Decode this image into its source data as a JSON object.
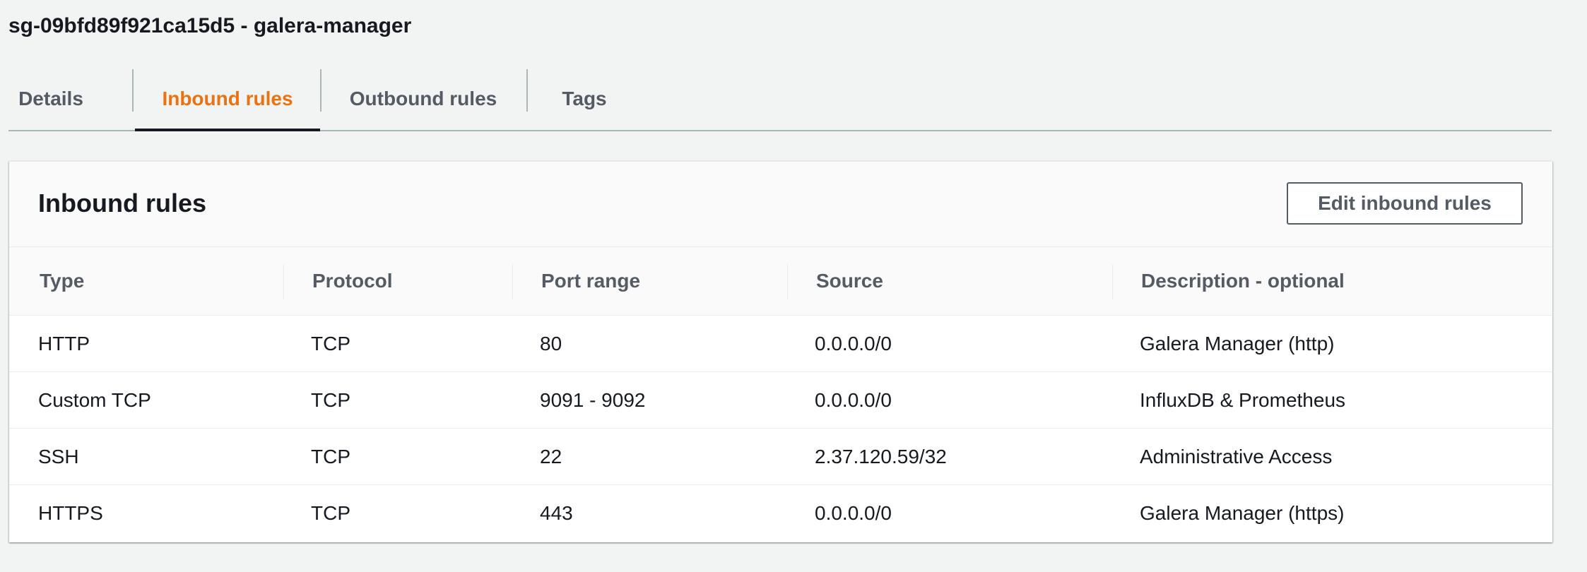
{
  "security_group": {
    "title": "sg-09bfd89f921ca15d5 - galera-manager"
  },
  "tabs": [
    {
      "label": "Details",
      "active": false
    },
    {
      "label": "Inbound rules",
      "active": true
    },
    {
      "label": "Outbound rules",
      "active": false
    },
    {
      "label": "Tags",
      "active": false
    }
  ],
  "panel": {
    "title": "Inbound rules",
    "edit_button_label": "Edit inbound rules"
  },
  "table": {
    "columns": [
      "Type",
      "Protocol",
      "Port range",
      "Source",
      "Description - optional"
    ],
    "rows": [
      {
        "type": "HTTP",
        "protocol": "TCP",
        "port_range": "80",
        "source": "0.0.0.0/0",
        "description": "Galera Manager (http)"
      },
      {
        "type": "Custom TCP",
        "protocol": "TCP",
        "port_range": "9091 - 9092",
        "source": "0.0.0.0/0",
        "description": "InfluxDB & Prometheus"
      },
      {
        "type": "SSH",
        "protocol": "TCP",
        "port_range": "22",
        "source": "2.37.120.59/32",
        "description": "Administrative Access"
      },
      {
        "type": "HTTPS",
        "protocol": "TCP",
        "port_range": "443",
        "source": "0.0.0.0/0",
        "description": "Galera Manager (https)"
      }
    ]
  },
  "colors": {
    "active_tab": "#ec7211",
    "text": "#16191f",
    "secondary_text": "#545b64",
    "background": "#f2f3f3"
  }
}
